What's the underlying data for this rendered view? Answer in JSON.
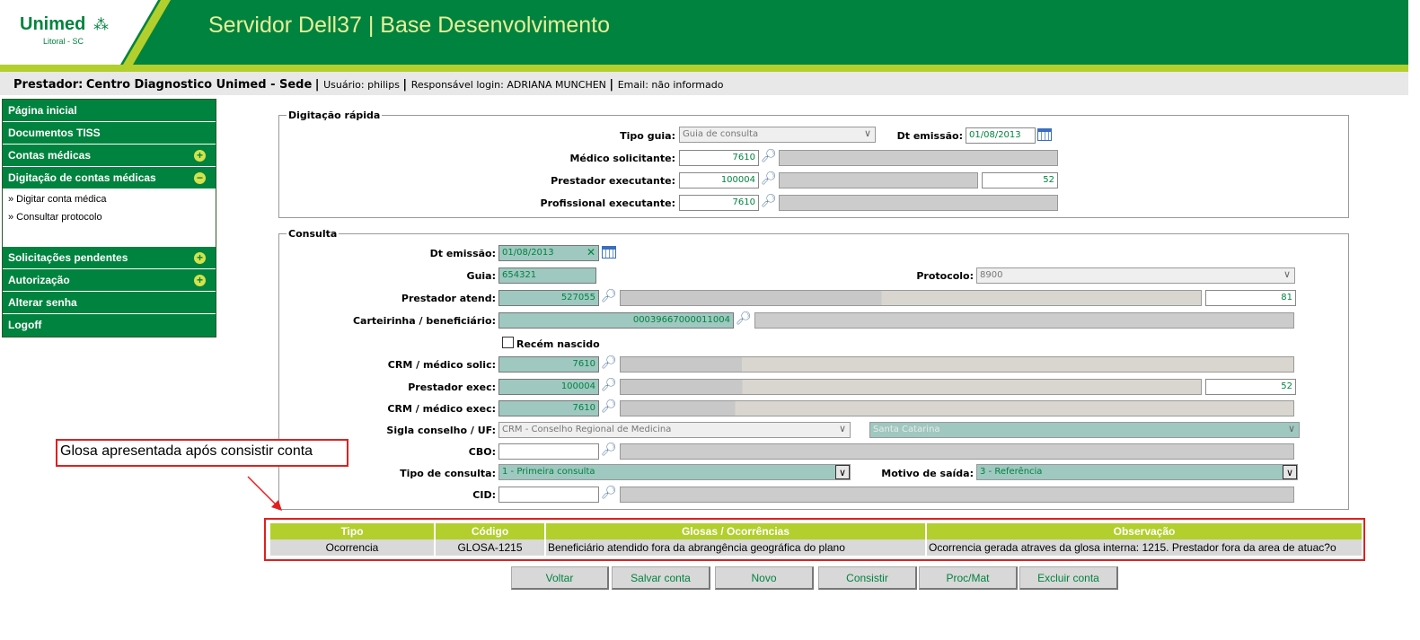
{
  "header": {
    "logo_text": "Unimed",
    "logo_sub": "Litoral - SC",
    "title": "Servidor Dell37 | Base Desenvolvimento"
  },
  "infobar": {
    "prestador_label": "Prestador:",
    "prestador_name": "Centro Diagnostico Unimed - Sede",
    "usuario": "Usuário: philips",
    "responsavel": "Responsável login: ADRIANA MUNCHEN",
    "email": "Email: não informado"
  },
  "sidebar": {
    "items": [
      {
        "label": "Página inicial"
      },
      {
        "label": "Documentos TISS"
      },
      {
        "label": "Contas médicas"
      },
      {
        "label": "Digitação de contas médicas"
      },
      {
        "label": "Solicitações pendentes"
      },
      {
        "label": "Autorização"
      },
      {
        "label": "Alterar senha"
      },
      {
        "label": "Logoff"
      }
    ],
    "subitems": [
      "» Digitar conta médica",
      "» Consultar protocolo"
    ]
  },
  "quick": {
    "legend": "Digitação rápida",
    "tipo_guia_label": "Tipo guia:",
    "tipo_guia_value": "Guia de consulta",
    "dt_emissao_label": "Dt emissão:",
    "dt_emissao_value": "01/08/2013",
    "medico_label": "Médico solicitante:",
    "medico_value": "7610",
    "prestador_label": "Prestador executante:",
    "prestador_value": "100004",
    "prestador_extra": "52",
    "profissional_label": "Profissional executante:",
    "profissional_value": "7610"
  },
  "consulta": {
    "legend": "Consulta",
    "dt_emissao_label": "Dt emissão:",
    "dt_emissao_value": "01/08/2013",
    "guia_label": "Guia:",
    "guia_value": "654321",
    "protocolo_label": "Protocolo:",
    "protocolo_value": "8900",
    "prestador_atend_label": "Prestador atend:",
    "prestador_atend_value": "527055",
    "prestador_atend_extra": "81",
    "carteirinha_label": "Carteirinha / beneficiário:",
    "carteirinha_value": "00039667000011004",
    "recem_nascido_label": "Recém nascido",
    "crm_solic_label": "CRM / médico solic:",
    "crm_solic_value": "7610",
    "prestador_exec_label": "Prestador exec:",
    "prestador_exec_value": "100004",
    "prestador_exec_extra": "52",
    "crm_exec_label": "CRM / médico exec:",
    "crm_exec_value": "7610",
    "sigla_label": "Sigla conselho / UF:",
    "sigla_value": "CRM - Conselho Regional de Medicina",
    "uf_value": "Santa Catarina",
    "cbo_label": "CBO:",
    "tipo_consulta_label": "Tipo de consulta:",
    "tipo_consulta_value": "1 - Primeira consulta",
    "motivo_label": "Motivo de saída:",
    "motivo_value": "3 - Referência",
    "cid_label": "CID:"
  },
  "callout": {
    "text": "Glosa apresentada após consistir conta"
  },
  "glosa_table": {
    "headers": [
      "Tipo",
      "Código",
      "Glosas / Ocorrências",
      "Observação"
    ],
    "row": [
      "Ocorrencia",
      "GLOSA-1215",
      "Beneficiário atendido fora da abrangência geográfica do plano",
      "Ocorrencia gerada atraves da glosa interna: 1215. Prestador fora da area de atuac?o"
    ]
  },
  "buttons": {
    "voltar": "Voltar",
    "salvar": "Salvar conta",
    "novo": "Novo",
    "consistir": "Consistir",
    "procmat": "Proc/Mat",
    "excluir": "Excluir conta"
  },
  "colors": {
    "brand_green": "#00833e",
    "accent_lime": "#b2cf2d",
    "highlight_red": "#e02020"
  }
}
